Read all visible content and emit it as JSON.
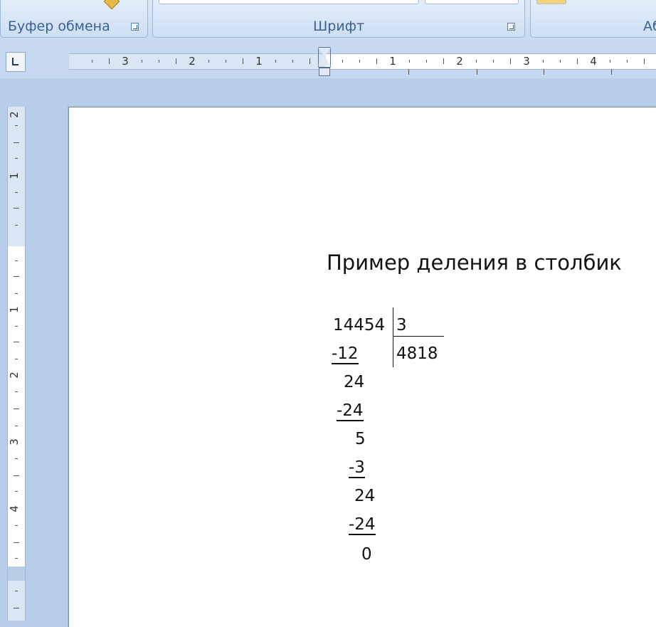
{
  "ribbon": {
    "groups": [
      {
        "title": "Буфер обмена"
      },
      {
        "title": "Шрифт"
      },
      {
        "title": "Аб"
      }
    ]
  },
  "ruler": {
    "horizontal_labels_left": [
      "3",
      "2",
      "1"
    ],
    "horizontal_labels_right": [
      "1",
      "2",
      "3",
      "4"
    ],
    "vertical_labels_top": [
      "2",
      "1"
    ],
    "vertical_labels_bottom": [
      "1",
      "2",
      "3",
      "4"
    ]
  },
  "document": {
    "title": "Пример деления в столбик",
    "dividend": "14454",
    "divisor": "3",
    "quotient": "4818",
    "steps": [
      "-12",
      "24",
      "-24",
      "5",
      "-3",
      "24",
      "-24",
      "0"
    ]
  }
}
